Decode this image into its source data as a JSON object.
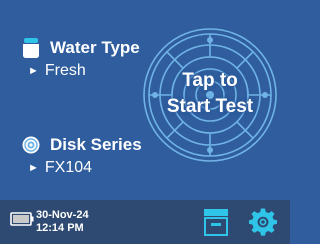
{
  "water_type": {
    "title": "Water Type",
    "value": "Fresh",
    "icon": "water-container-icon"
  },
  "disk_series": {
    "title": "Disk Series",
    "value": "FX104",
    "icon": "disk-icon"
  },
  "start_test": {
    "line1": "Tap to",
    "line2": "Start Test"
  },
  "status_bar": {
    "date": "30-Nov-24",
    "time": "12:14 PM",
    "battery_icon": "battery-icon",
    "archive_icon": "archive-icon",
    "settings_icon": "gear-icon"
  },
  "colors": {
    "background": "#2f5d9d",
    "footer": "#2e4a72",
    "accent": "#2fc5e8",
    "disk_ring": "#6fb3e6",
    "text": "#ffffff"
  }
}
